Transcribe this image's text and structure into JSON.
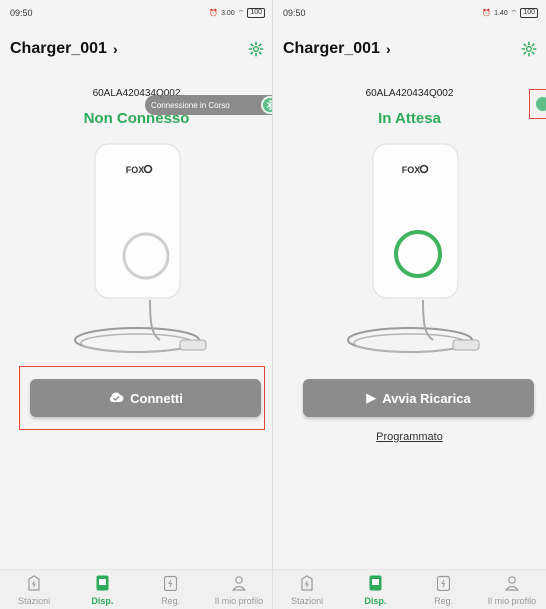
{
  "status_bar": {
    "left_time": "09:50",
    "right_time": "09:50",
    "left_speed": "3.00",
    "right_speed": "1.40",
    "battery": "100"
  },
  "device": {
    "title": "Charger_001",
    "serial": "60ALA420434Q002",
    "brand": "FOX"
  },
  "left": {
    "state": "Non Connesso",
    "toast": "Connessione in Corso",
    "button": "Connetti"
  },
  "right": {
    "state": "In Attesa",
    "button": "Avvia Ricarica",
    "scheduled_link": "Programmato"
  },
  "tabs": [
    {
      "label": "Stazioni",
      "icon": "station-icon",
      "active": false
    },
    {
      "label": "Disp.",
      "icon": "device-icon",
      "active": true
    },
    {
      "label": "Reg.",
      "icon": "records-icon",
      "active": false
    },
    {
      "label": "Il mio profilo",
      "icon": "profile-icon",
      "active": false
    }
  ],
  "colors": {
    "accent_green": "#2eab5a",
    "button_gray": "#8c8c8c",
    "highlight_red": "#e0483a"
  }
}
